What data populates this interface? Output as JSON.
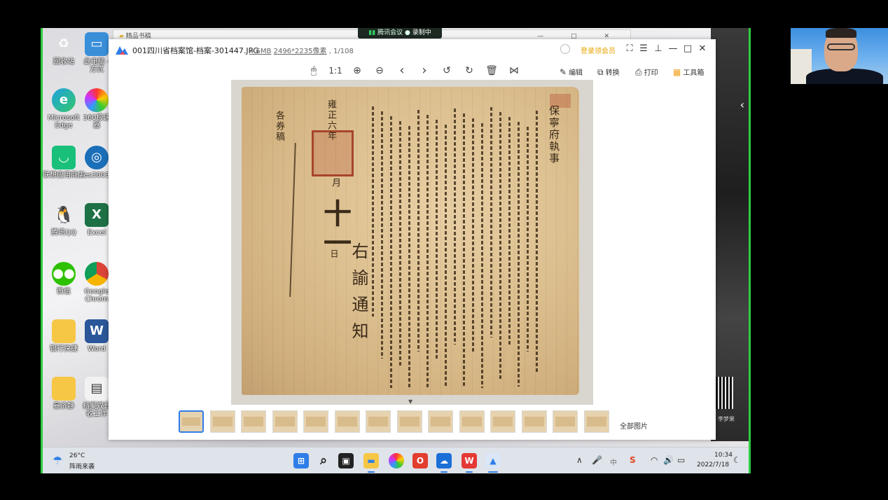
{
  "meeting": {
    "app": "腾讯会议",
    "status": "录制中"
  },
  "back_window": {
    "title": "精品书稿",
    "controls": "—  □  ✕"
  },
  "desktop_icons": [
    {
      "label": "回收站",
      "icon": "recycle-bin-icon"
    },
    {
      "label": "此电脑 - 方式",
      "icon": "computer-icon"
    },
    {
      "label": "Microsoft Edge",
      "icon": "edge-icon"
    },
    {
      "label": "360极速 器",
      "icon": "browser-360-icon"
    },
    {
      "label": "联想应用商店",
      "icon": "lenovo-store-icon"
    },
    {
      "label": "es3003",
      "icon": "es-icon"
    },
    {
      "label": "腾讯QQ",
      "icon": "qq-icon"
    },
    {
      "label": "Excel",
      "icon": "excel-icon"
    },
    {
      "label": "微信",
      "icon": "wechat-icon"
    },
    {
      "label": "Google Chrom",
      "icon": "chrome-icon"
    },
    {
      "label": "银行快捷",
      "icon": "folder-icon"
    },
    {
      "label": "Word",
      "icon": "word-icon"
    },
    {
      "label": "曼济静",
      "icon": "folder-icon"
    },
    {
      "label": "档案双套 收工作",
      "icon": "document-icon"
    }
  ],
  "viewer": {
    "file_name": "001四川省档案馆-档案-301447.JPG",
    "file_size": "4.6MB",
    "dimensions": "2496*2235像素",
    "page_index": ", 1/108",
    "login_label": "登录领会员",
    "toolbar": {
      "actual_size": "1:1",
      "edit": "编辑",
      "convert": "转换",
      "print": "打印",
      "toolbox": "工具箱"
    },
    "document": {
      "col_right_title": "保寧府執事",
      "col_date": "雍正六年",
      "col_month": "月",
      "col_day": "十一",
      "col_ri": "日",
      "col_side": "右諭通知",
      "col_left": "各券稿"
    },
    "all_images_label": "全部图片",
    "thumbnail_count": 14
  },
  "side_panel": {
    "qr_caption": "- 李梦果"
  },
  "taskbar": {
    "weather_temp": "26°C",
    "weather_desc": "阵雨来袭",
    "time": "10:34",
    "date": "2022/7/18",
    "ime": "中"
  },
  "colors": {
    "accent": "#2f7ee8",
    "vip": "#e8a400",
    "screen_border": "#2ecc40",
    "seal": "#a8452c"
  }
}
